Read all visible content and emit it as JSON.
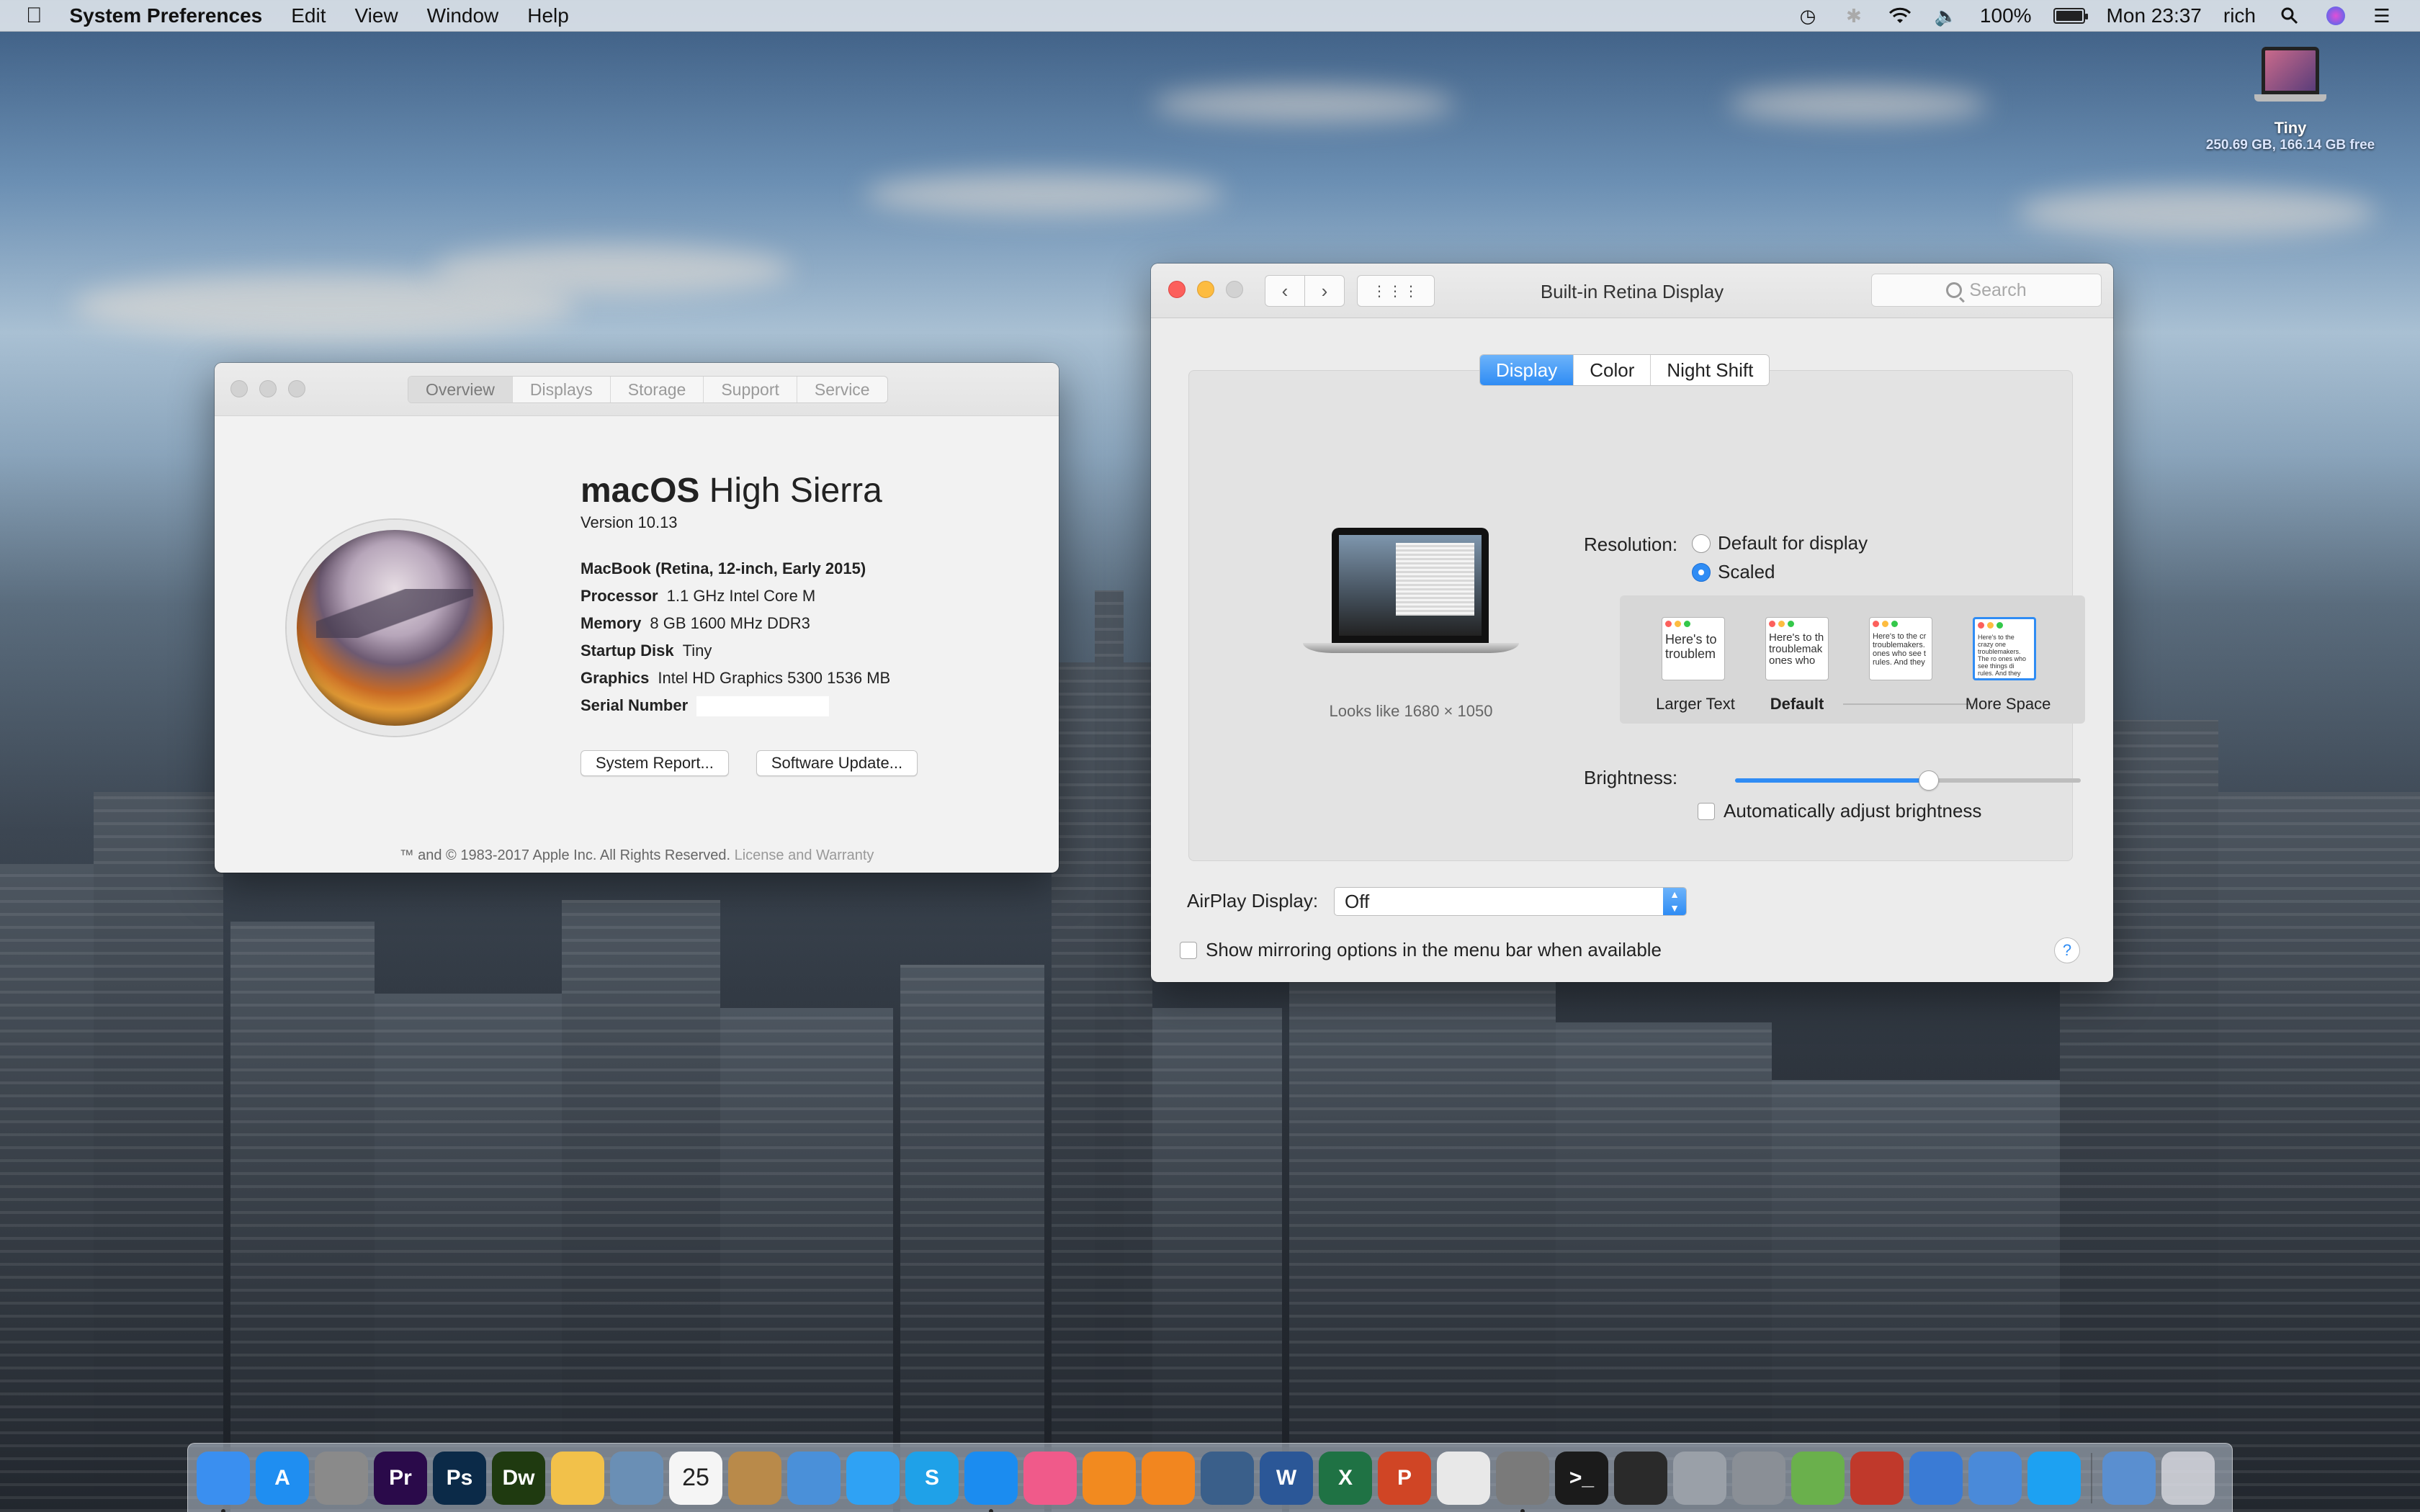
{
  "menubar": {
    "app_name": "System Preferences",
    "items": [
      "Edit",
      "View",
      "Window",
      "Help"
    ],
    "battery_percent": "100%",
    "battery_level": 1.0,
    "clock": "Mon 23:37",
    "user": "rich",
    "status_icons": [
      "time-machine-icon",
      "bluetooth-icon",
      "wifi-icon",
      "volume-icon",
      "battery-icon",
      "spotlight-icon",
      "siri-icon",
      "notification-center-icon"
    ]
  },
  "desktop": {
    "drive_name": "Tiny",
    "drive_info": "250.69 GB, 166.14 GB free"
  },
  "about_window": {
    "tabs": [
      "Overview",
      "Displays",
      "Storage",
      "Support",
      "Service"
    ],
    "selected_tab": "Overview",
    "os_name_bold": "macOS",
    "os_name_rest": " High Sierra",
    "version": "Version 10.13",
    "model": "MacBook (Retina, 12-inch, Early 2015)",
    "processor_label": "Processor",
    "processor": "1.1 GHz Intel Core M",
    "memory_label": "Memory",
    "memory": "8 GB 1600 MHz DDR3",
    "disk_label": "Startup Disk",
    "disk": "Tiny",
    "graphics_label": "Graphics",
    "graphics": "Intel HD Graphics 5300 1536 MB",
    "serial_label": "Serial Number",
    "system_report_button": "System Report...",
    "software_update_button": "Software Update...",
    "footer": "™ and © 1983-2017 Apple Inc. All Rights Reserved.",
    "footer_link": "License and Warranty"
  },
  "display_window": {
    "title": "Built-in Retina Display",
    "search_placeholder": "Search",
    "tabs": [
      "Display",
      "Color",
      "Night Shift"
    ],
    "selected_tab": "Display",
    "looks_like": "Looks like 1680 × 1050",
    "resolution_label": "Resolution:",
    "resolution_options": [
      "Default for display",
      "Scaled"
    ],
    "resolution_selected": "Scaled",
    "thumb_text": [
      "Here's to troublem",
      "Here's to th troublemak ones who",
      "Here's to the cr troublemakers. ones who see t rules. And they",
      "Here's to the crazy one troublemakers. The ro ones who see things di rules. And they have no can quote them, disagr them. About the only th Because they change th"
    ],
    "thumb_labels": [
      "Larger Text",
      "Default",
      "More Space"
    ],
    "selected_scale": 4,
    "brightness_label": "Brightness:",
    "brightness_level": 0.56,
    "auto_brightness_label": "Automatically adjust brightness",
    "airplay_label": "AirPlay Display:",
    "airplay_value": "Off",
    "mirroring_label": "Show mirroring options in the menu bar when available",
    "help": "?"
  },
  "dock": {
    "items": [
      {
        "name": "finder-icon",
        "label": "",
        "color": "#3a8ff0",
        "run": true
      },
      {
        "name": "app-store-icon",
        "label": "A",
        "color": "#1f8ef1",
        "run": false
      },
      {
        "name": "calculator-icon",
        "label": "",
        "color": "#8a8a8a",
        "run": false
      },
      {
        "name": "premiere-icon",
        "label": "Pr",
        "color": "#2a0a4a",
        "run": false
      },
      {
        "name": "photoshop-icon",
        "label": "Ps",
        "color": "#0b2a48",
        "run": false
      },
      {
        "name": "dreamweaver-icon",
        "label": "Dw",
        "color": "#1f3a10",
        "run": false
      },
      {
        "name": "photos-icon",
        "label": "",
        "color": "#f2c14a",
        "run": false
      },
      {
        "name": "preview-icon",
        "label": "",
        "color": "#6a8fb5",
        "run": false
      },
      {
        "name": "calendar-icon",
        "label": "25",
        "color": "#f5f5f5",
        "run": false
      },
      {
        "name": "contacts-icon",
        "label": "",
        "color": "#b98a4a",
        "run": false
      },
      {
        "name": "mail-icon",
        "label": "",
        "color": "#4a90d9",
        "run": false
      },
      {
        "name": "messages-icon",
        "label": "",
        "color": "#2fa2f4",
        "run": false
      },
      {
        "name": "skype-icon",
        "label": "S",
        "color": "#1fa1e8",
        "run": false
      },
      {
        "name": "safari-icon",
        "label": "",
        "color": "#1b8cf0",
        "run": true
      },
      {
        "name": "itunes-icon",
        "label": "",
        "color": "#f05a8a",
        "run": false
      },
      {
        "name": "ibooks-icon",
        "label": "",
        "color": "#f28a1f",
        "run": false
      },
      {
        "name": "vlc-icon",
        "label": "",
        "color": "#f2861f",
        "run": false
      },
      {
        "name": "quicktime-icon",
        "label": "",
        "color": "#3a5f8a",
        "run": false
      },
      {
        "name": "word-icon",
        "label": "W",
        "color": "#2b5797",
        "run": false
      },
      {
        "name": "excel-icon",
        "label": "X",
        "color": "#1f7244",
        "run": false
      },
      {
        "name": "powerpoint-icon",
        "label": "P",
        "color": "#d04525",
        "run": false
      },
      {
        "name": "textedit-icon",
        "label": "",
        "color": "#e8e8e8",
        "run": false
      },
      {
        "name": "system-preferences-icon",
        "label": "",
        "color": "#7a7a7a",
        "run": true
      },
      {
        "name": "terminal-icon",
        "label": ">_",
        "color": "#1b1b1b",
        "run": false
      },
      {
        "name": "activity-monitor-icon",
        "label": "",
        "color": "#2a2a2a",
        "run": false
      },
      {
        "name": "disk-utility-icon",
        "label": "",
        "color": "#9aa0a8",
        "run": false
      },
      {
        "name": "system-information-icon",
        "label": "",
        "color": "#8a8f96",
        "run": false
      },
      {
        "name": "maps-icon",
        "label": "",
        "color": "#6ab04c",
        "run": false
      },
      {
        "name": "photo-booth-icon",
        "label": "",
        "color": "#c0392b",
        "run": false
      },
      {
        "name": "migration-assistant-icon",
        "label": "",
        "color": "#3a7bd5",
        "run": false
      },
      {
        "name": "remote-desktop-icon",
        "label": "",
        "color": "#4a8ad9",
        "run": false
      },
      {
        "name": "twitter-icon",
        "label": "",
        "color": "#1da1f2",
        "run": false
      }
    ],
    "home_folder_icon": "home-folder-icon",
    "trash_icon": "trash-icon"
  }
}
